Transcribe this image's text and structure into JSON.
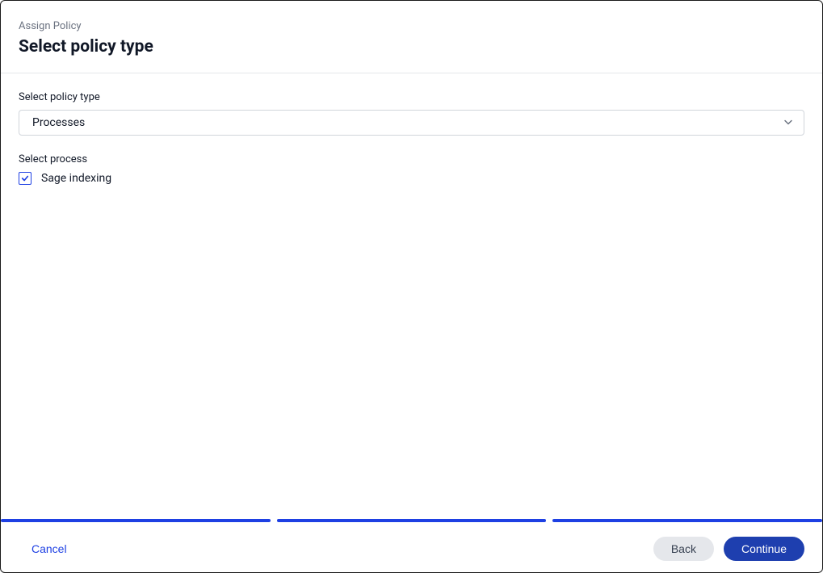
{
  "header": {
    "breadcrumb": "Assign Policy",
    "title": "Select policy type"
  },
  "form": {
    "policy_type_label": "Select policy type",
    "policy_type_value": "Processes",
    "process_label": "Select process",
    "process_option": "Sage indexing",
    "process_checked": true
  },
  "footer": {
    "cancel": "Cancel",
    "back": "Back",
    "continue": "Continue"
  }
}
